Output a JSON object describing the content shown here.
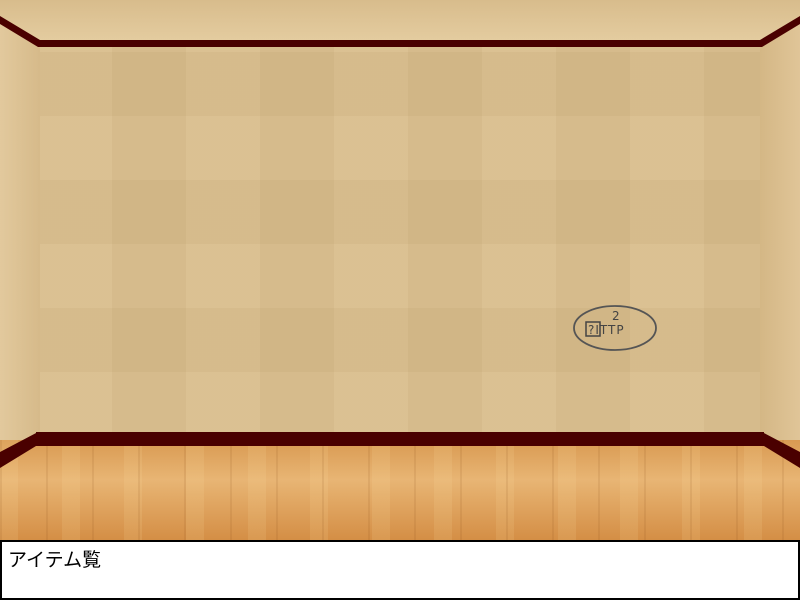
{
  "room": {
    "wall_color": "#d9bd8b",
    "trim_color": "#4a0000",
    "floor_color": "#e0a660"
  },
  "wall_mark": {
    "icon": "circled-symbol-clue",
    "number": "2",
    "symbols": "?ITTP"
  },
  "inventory": {
    "title": "アイテム覧",
    "items": []
  }
}
